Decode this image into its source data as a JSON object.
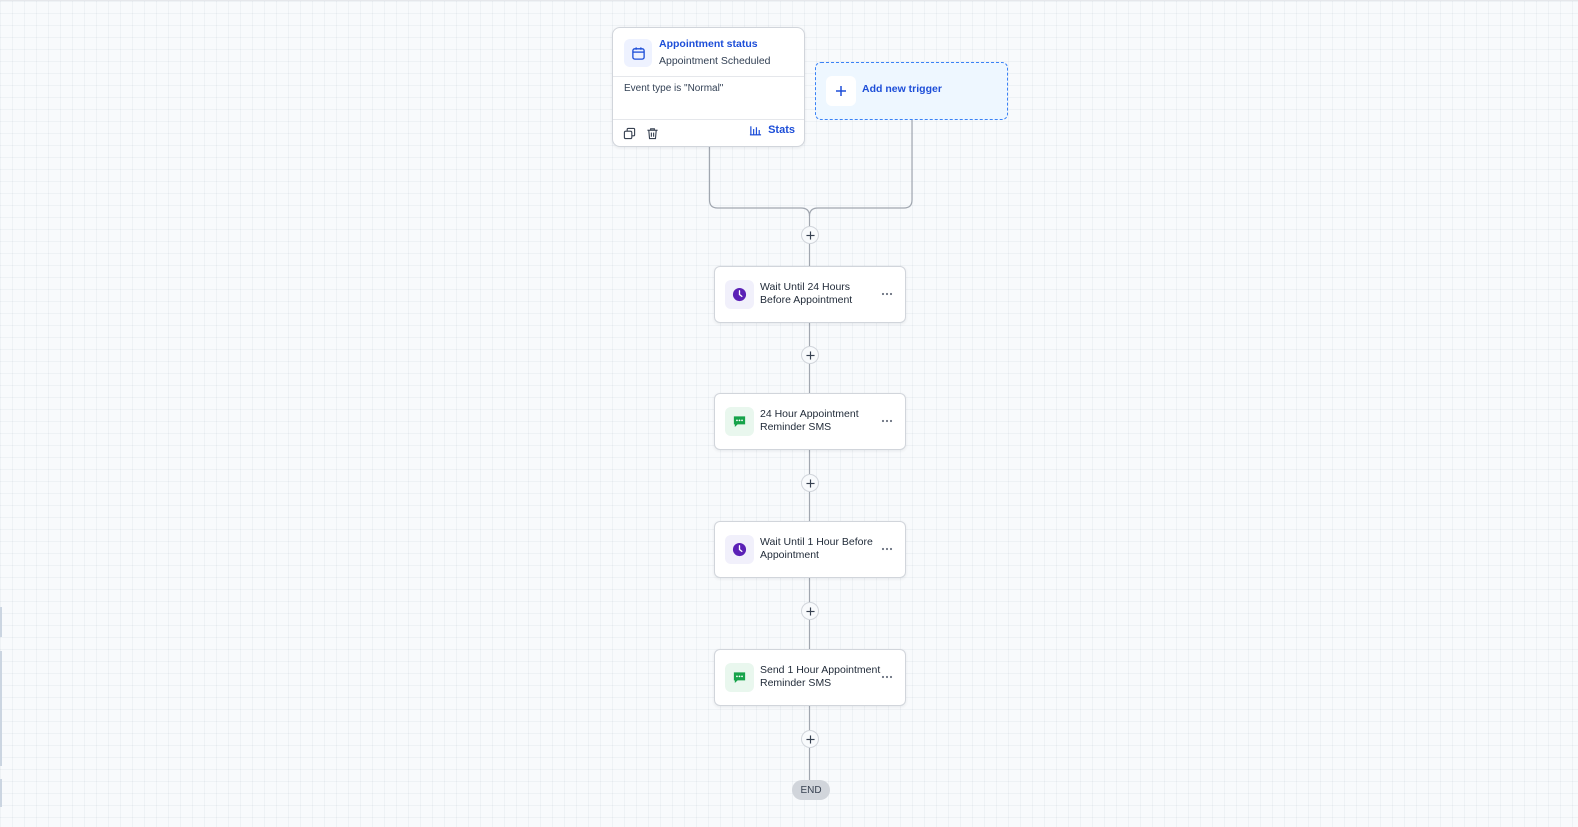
{
  "trigger": {
    "icon": "calendar-icon",
    "title": "Appointment status",
    "subtitle": "Appointment Scheduled",
    "filter": "Event type is \"Normal\"",
    "stats_label": "Stats",
    "footer_icons": [
      "copy-icon",
      "trash-icon",
      "bar-chart-icon"
    ]
  },
  "add_trigger": {
    "label": "Add new trigger",
    "icon": "plus-icon"
  },
  "actions": [
    {
      "label": "Wait Until 24 Hours Before Appointment",
      "type": "wait",
      "icon": "clock-icon"
    },
    {
      "label": "24 Hour Appointment Reminder SMS",
      "type": "sms",
      "icon": "message-icon"
    },
    {
      "label": "Wait Until 1 Hour Before Appointment",
      "type": "wait",
      "icon": "clock-icon"
    },
    {
      "label": "Send 1 Hour Appointment Reminder SMS",
      "type": "sms",
      "icon": "message-icon"
    }
  ],
  "end_label": "END",
  "colors": {
    "accent_blue": "#1d4ed8",
    "wait_purple": "#5b21b6",
    "sms_green": "#16a34a",
    "connector": "#9ca3af"
  }
}
